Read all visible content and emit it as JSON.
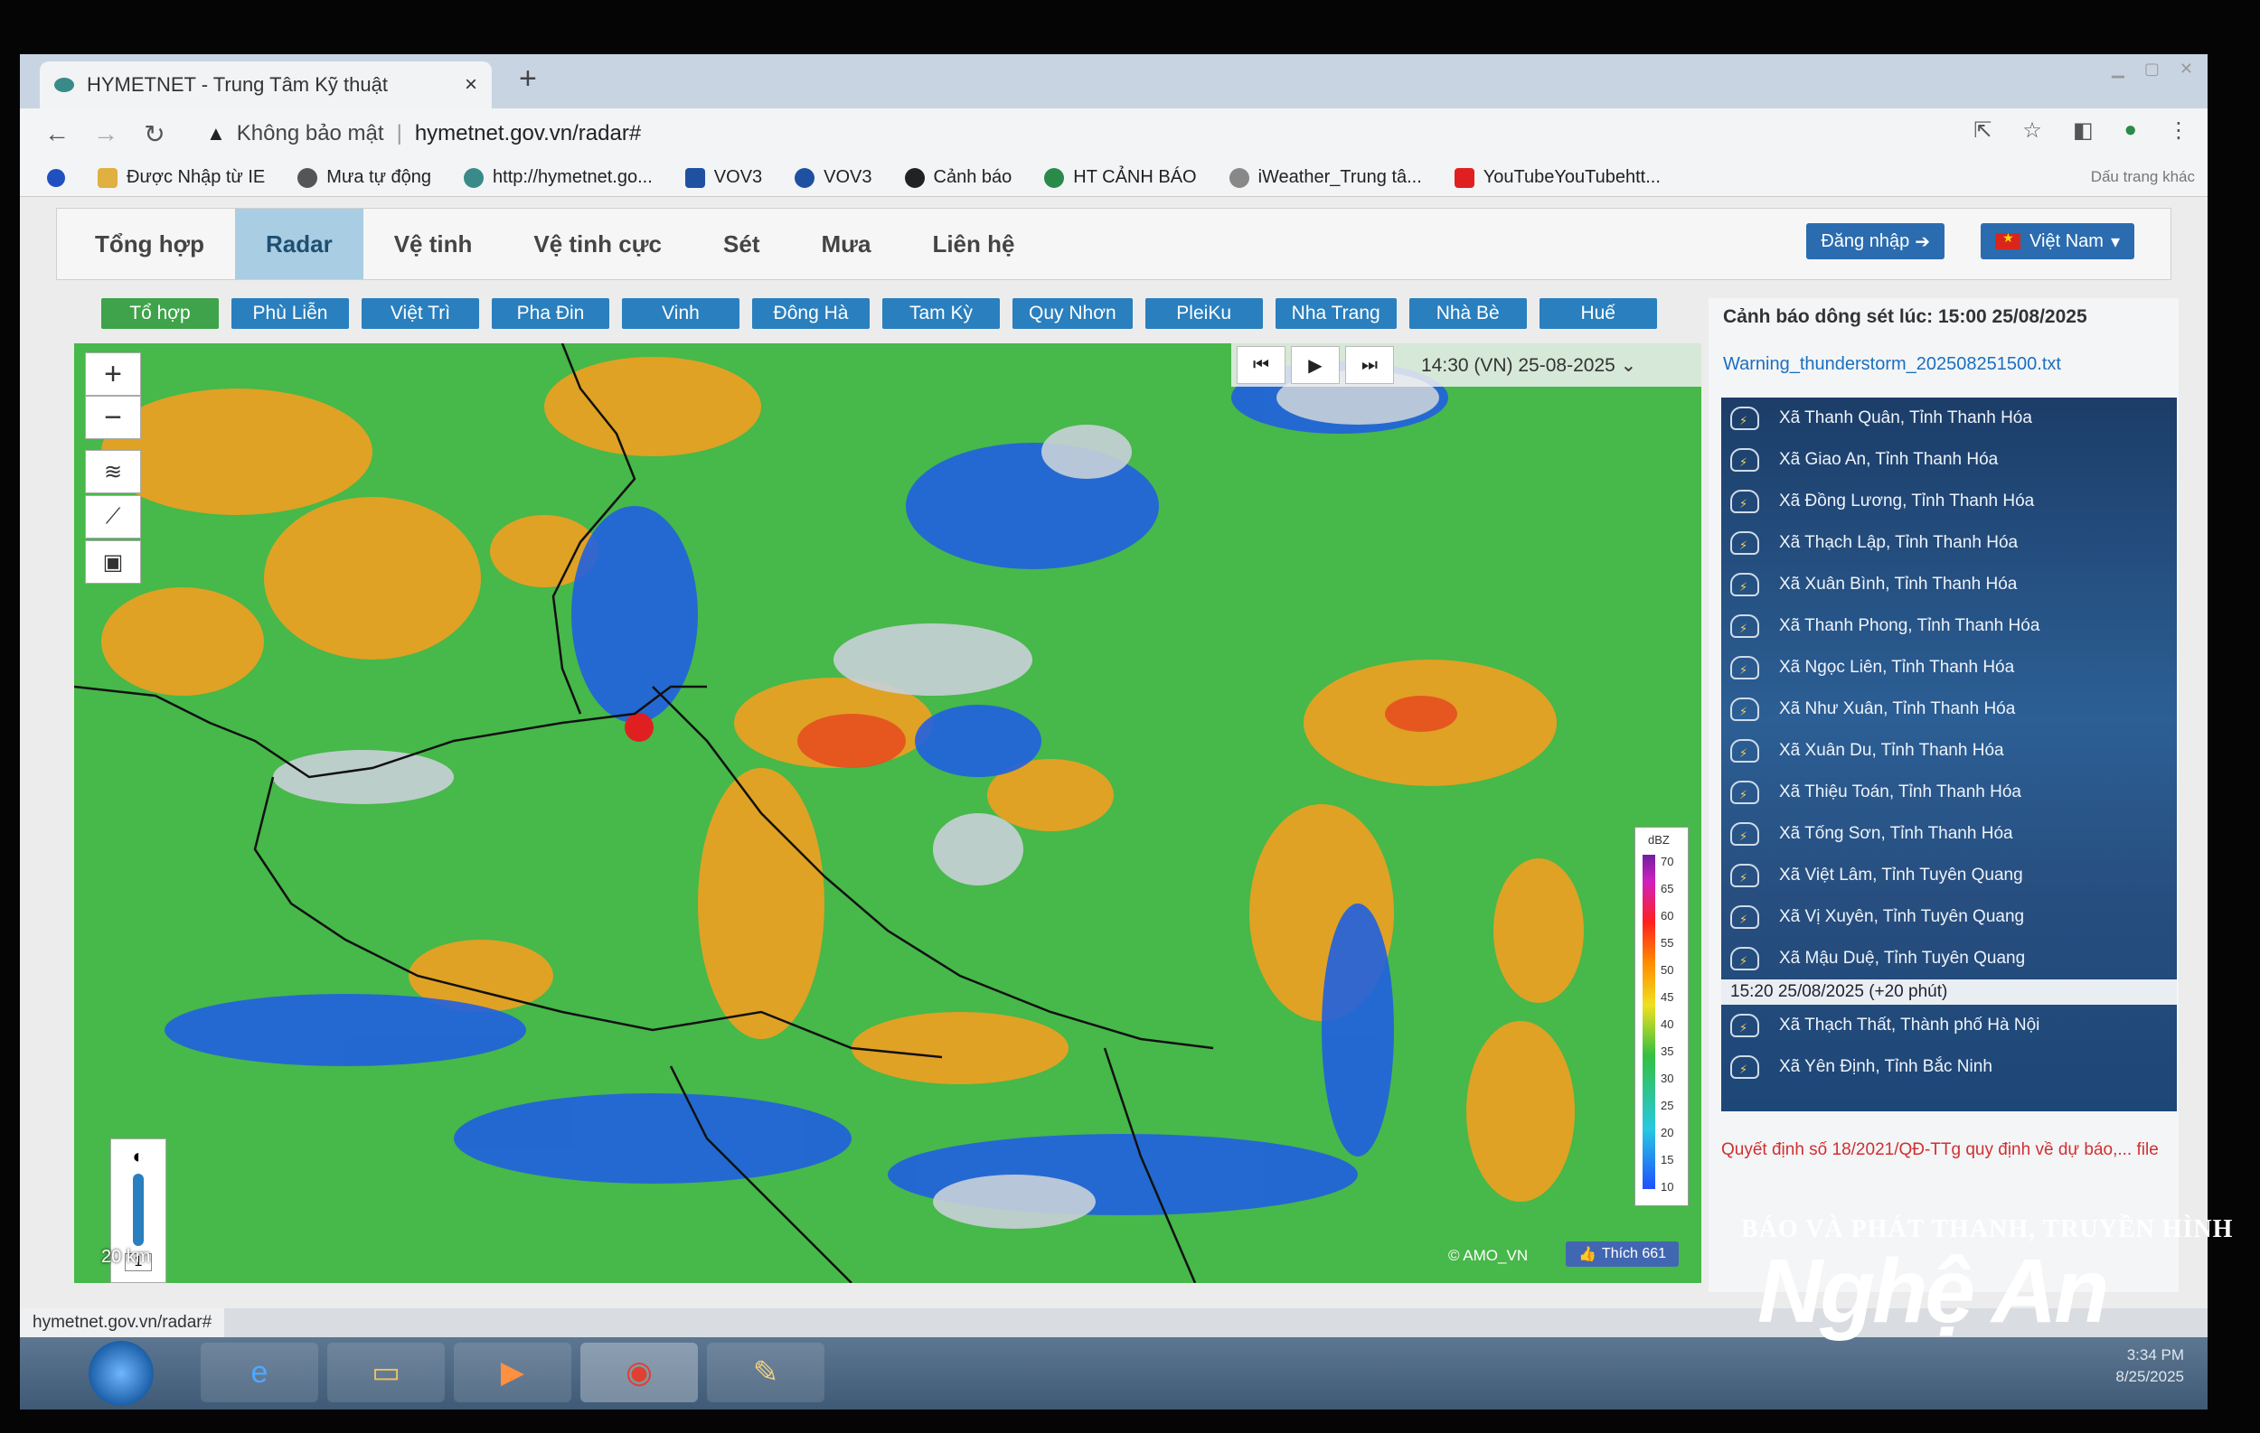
{
  "browser": {
    "tab_title": "HYMETNET - Trung Tâm Kỹ thuật",
    "tab_close": "×",
    "new_tab": "+",
    "security_label": "Không bảo mật",
    "url": "hymetnet.gov.vn/radar#"
  },
  "bookmarks": [
    {
      "label": "Được Nhập từ IE",
      "color": "#e0b040"
    },
    {
      "label": "Mưa tự động",
      "color": "#555555"
    },
    {
      "label": "http://hymetnet.go...",
      "color": "#3a8a8a"
    },
    {
      "label": "VOV3",
      "color": "#2050a0"
    },
    {
      "label": "VOV3",
      "color": "#2050a0"
    },
    {
      "label": "Cảnh báo",
      "color": "#222222"
    },
    {
      "label": "HT CẢNH BÁO",
      "color": "#2a8a4a"
    },
    {
      "label": "iWeather_Trung tâ...",
      "color": "#888888"
    },
    {
      "label": "YouTubeYouTubehtt...",
      "color": "#e02020"
    }
  ],
  "bookmarks_other": "Dấu trang khác",
  "site_nav": {
    "items": [
      "Tổng hợp",
      "Radar",
      "Vệ tinh",
      "Vệ tinh cực",
      "Sét",
      "Mưa",
      "Liên hệ"
    ],
    "active": "Radar",
    "login": "Đăng nhập",
    "language": "Việt Nam"
  },
  "stations": {
    "items": [
      "Tổ hợp",
      "Phù Liễn",
      "Việt Trì",
      "Pha Đin",
      "Vinh",
      "Đông Hà",
      "Tam Kỳ",
      "Quy Nhơn",
      "PleiKu",
      "Nha Trang",
      "Nhà Bè",
      "Huế"
    ],
    "active": "Tổ hợp"
  },
  "map": {
    "time": "14:30 (VN) 25-08-2025",
    "zoom_in": "+",
    "zoom_out": "−",
    "scale": "20 km",
    "zoom_level": "1",
    "attribution": "© AMO_VN",
    "like_label": "Thích 661",
    "legend_unit": "dBZ",
    "legend_values": [
      "70",
      "65",
      "60",
      "55",
      "50",
      "45",
      "40",
      "35",
      "30",
      "25",
      "20",
      "15",
      "10"
    ]
  },
  "panel": {
    "title": "Cảnh báo dông sét lúc: 15:00 25/08/2025",
    "link": "Warning_thunderstorm_202508251500.txt",
    "warnings": [
      "Xã Thanh Quân, Tỉnh Thanh Hóa",
      "Xã Giao An, Tỉnh Thanh Hóa",
      "Xã Đồng Lương, Tỉnh Thanh Hóa",
      "Xã Thạch Lập, Tỉnh Thanh Hóa",
      "Xã Xuân Bình, Tỉnh Thanh Hóa",
      "Xã Thanh Phong, Tỉnh Thanh Hóa",
      "Xã Ngọc Liên, Tỉnh Thanh Hóa",
      "Xã Như Xuân, Tỉnh Thanh Hóa",
      "Xã Xuân Du, Tỉnh Thanh Hóa",
      "Xã Thiệu Toán, Tỉnh Thanh Hóa",
      "Xã Tống Sơn, Tỉnh Thanh Hóa",
      "Xã Việt Lâm, Tỉnh Tuyên Quang",
      "Xã Vị Xuyên, Tỉnh Tuyên Quang",
      "Xã Mậu Duệ, Tỉnh Tuyên Quang"
    ],
    "section2": "15:20 25/08/2025 (+20 phút)",
    "warnings2": [
      "Xã Thạch Thất, Thành phố Hà Nội",
      "Xã Yên Định, Tỉnh Bắc Ninh"
    ],
    "note": "Quyết định số 18/2021/QĐ-TTg quy định về dự báo,... file"
  },
  "status_url": "hymetnet.gov.vn/radar#",
  "clock": {
    "time": "3:34 PM",
    "date": "8/25/2025"
  },
  "watermark": {
    "top": "BÁO VÀ PHÁT THANH, TRUYỀN HÌNH",
    "main": "Nghệ An"
  },
  "colors": {
    "accent": "#2a7fbe",
    "active_station": "#3ea34a",
    "active_nav": "#a9cde3",
    "radar_green": "#47b84a",
    "radar_orange": "#f0a020",
    "radar_blue": "#2060e0"
  }
}
